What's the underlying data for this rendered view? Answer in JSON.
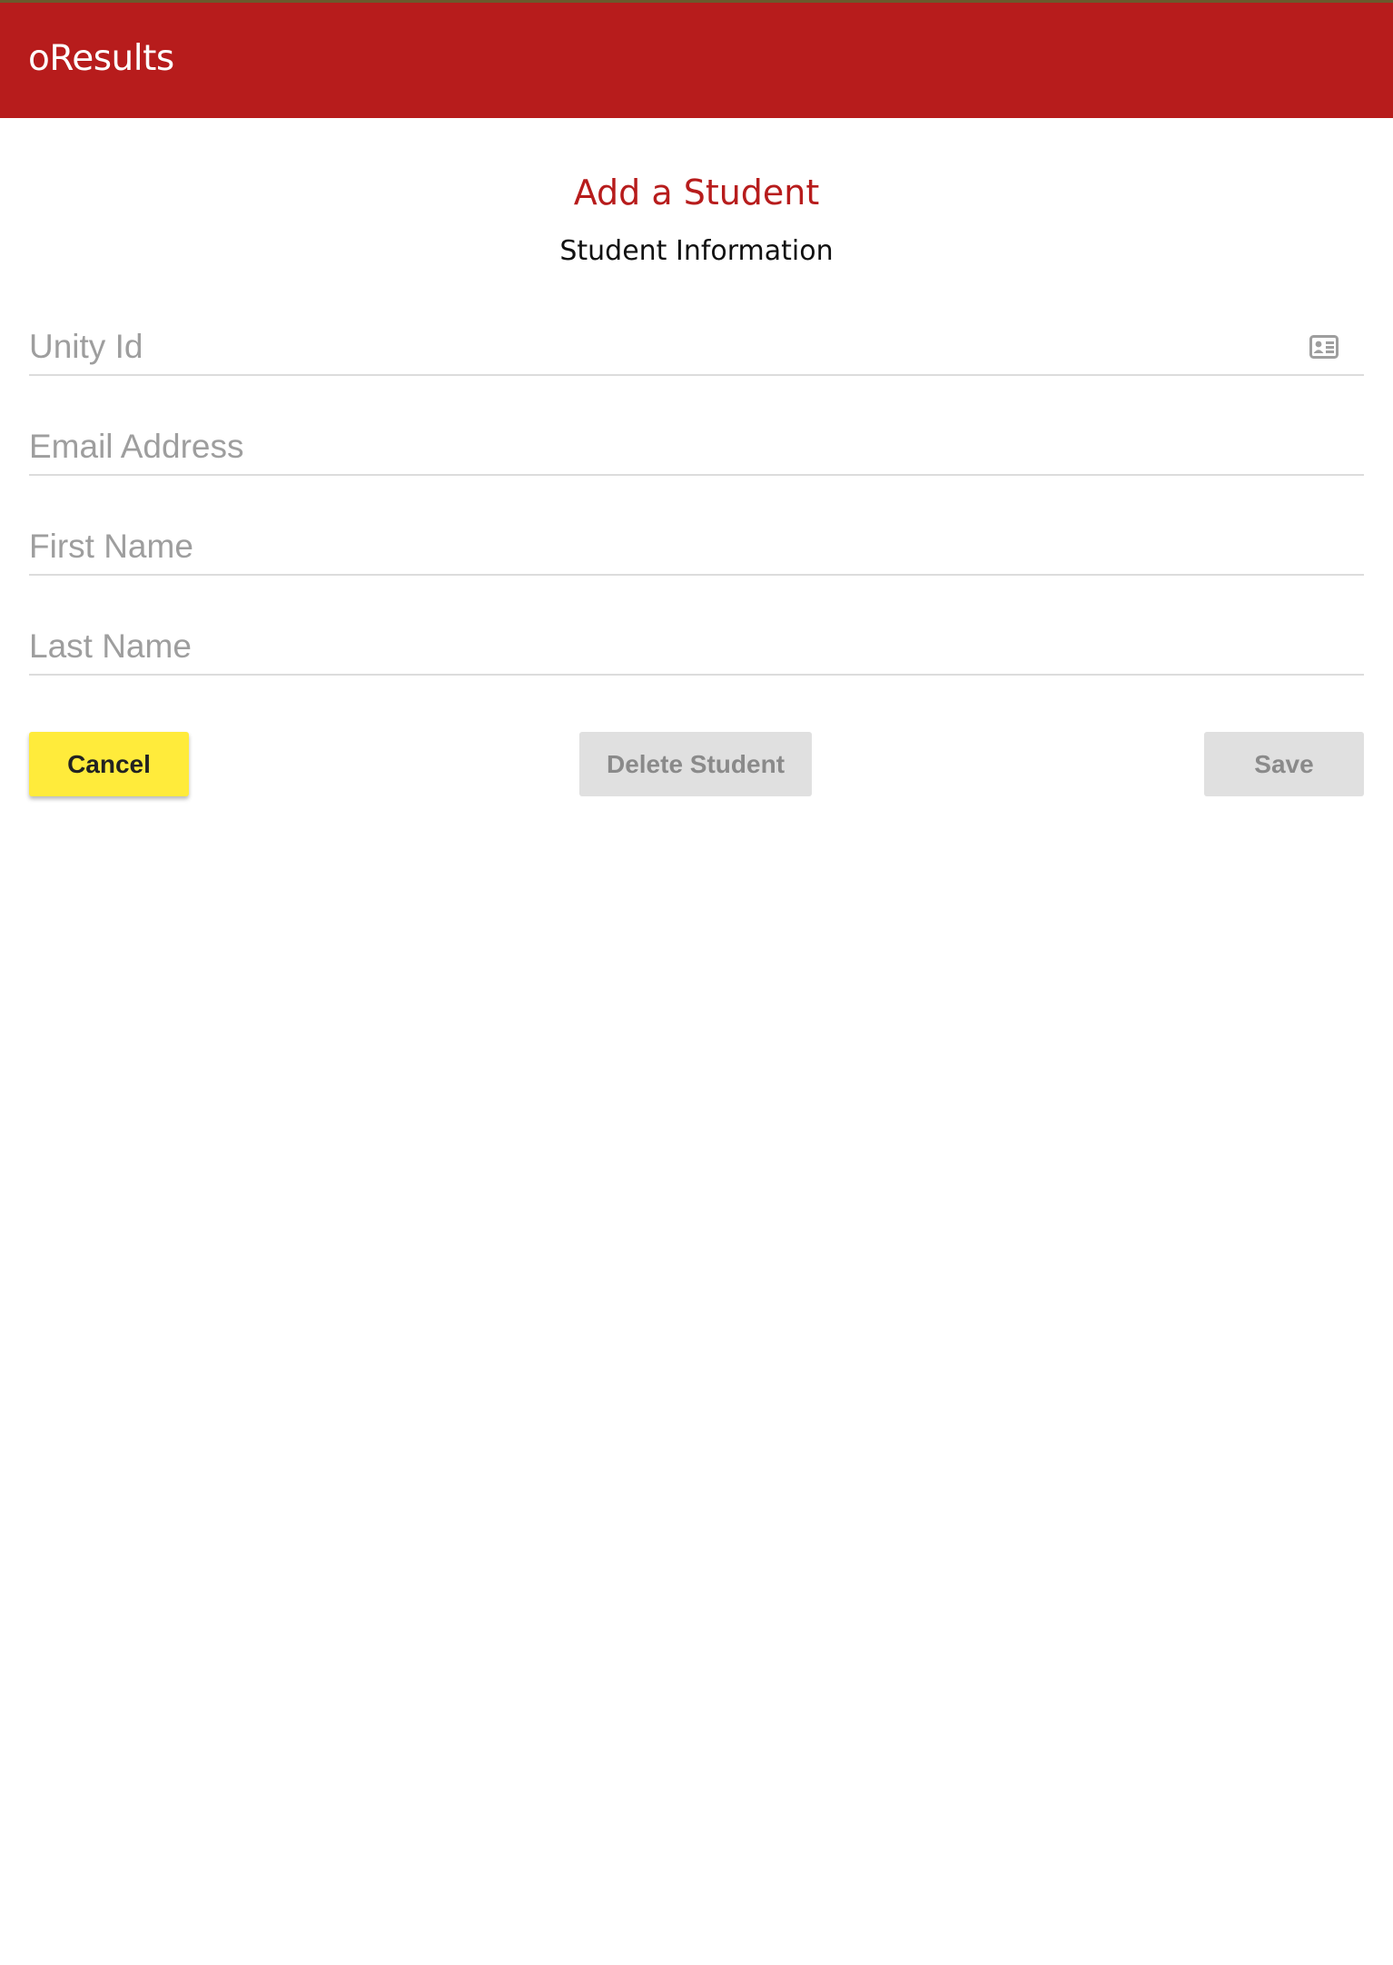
{
  "app": {
    "title": "oResults"
  },
  "page": {
    "title": "Add a Student",
    "subtitle": "Student Information"
  },
  "form": {
    "unity_id": {
      "placeholder": "Unity Id",
      "value": "",
      "icon": "id-card-icon"
    },
    "email": {
      "placeholder": "Email Address",
      "value": ""
    },
    "first_name": {
      "placeholder": "First Name",
      "value": ""
    },
    "last_name": {
      "placeholder": "Last Name",
      "value": ""
    }
  },
  "actions": {
    "cancel_label": "Cancel",
    "delete_label": "Delete Student",
    "save_label": "Save"
  },
  "colors": {
    "header": "#b71c1c",
    "title": "#b71c1c",
    "cancel_button": "#ffeb3b",
    "disabled_button": "#e0e0e0"
  }
}
